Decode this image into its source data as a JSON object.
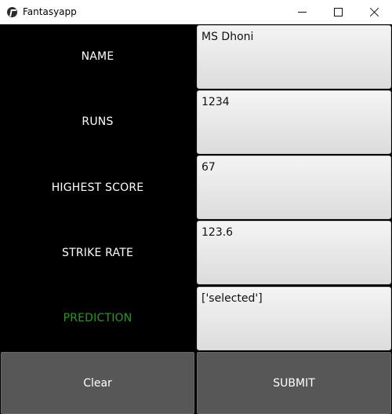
{
  "window": {
    "title": "Fantasyapp",
    "icon": "kivy-app-icon",
    "controls": [
      "minimize",
      "maximize",
      "close"
    ]
  },
  "form": {
    "name": {
      "label": "NAME",
      "value": "MS Dhoni"
    },
    "runs": {
      "label": "RUNS",
      "value": "1234"
    },
    "highest_score": {
      "label": "HIGHEST SCORE",
      "value": "67"
    },
    "strike_rate": {
      "label": "STRIKE RATE",
      "value": "123.6"
    },
    "prediction": {
      "label": "PREDICTION",
      "value": "['selected']"
    }
  },
  "actions": {
    "clear_label": "Clear",
    "submit_label": "SUBMIT"
  },
  "colors": {
    "background": "#000000",
    "label_text": "#ffffff",
    "prediction_label": "#1f9d1f",
    "field_bg": "#e8e8e8",
    "button_bg": "#575757"
  }
}
